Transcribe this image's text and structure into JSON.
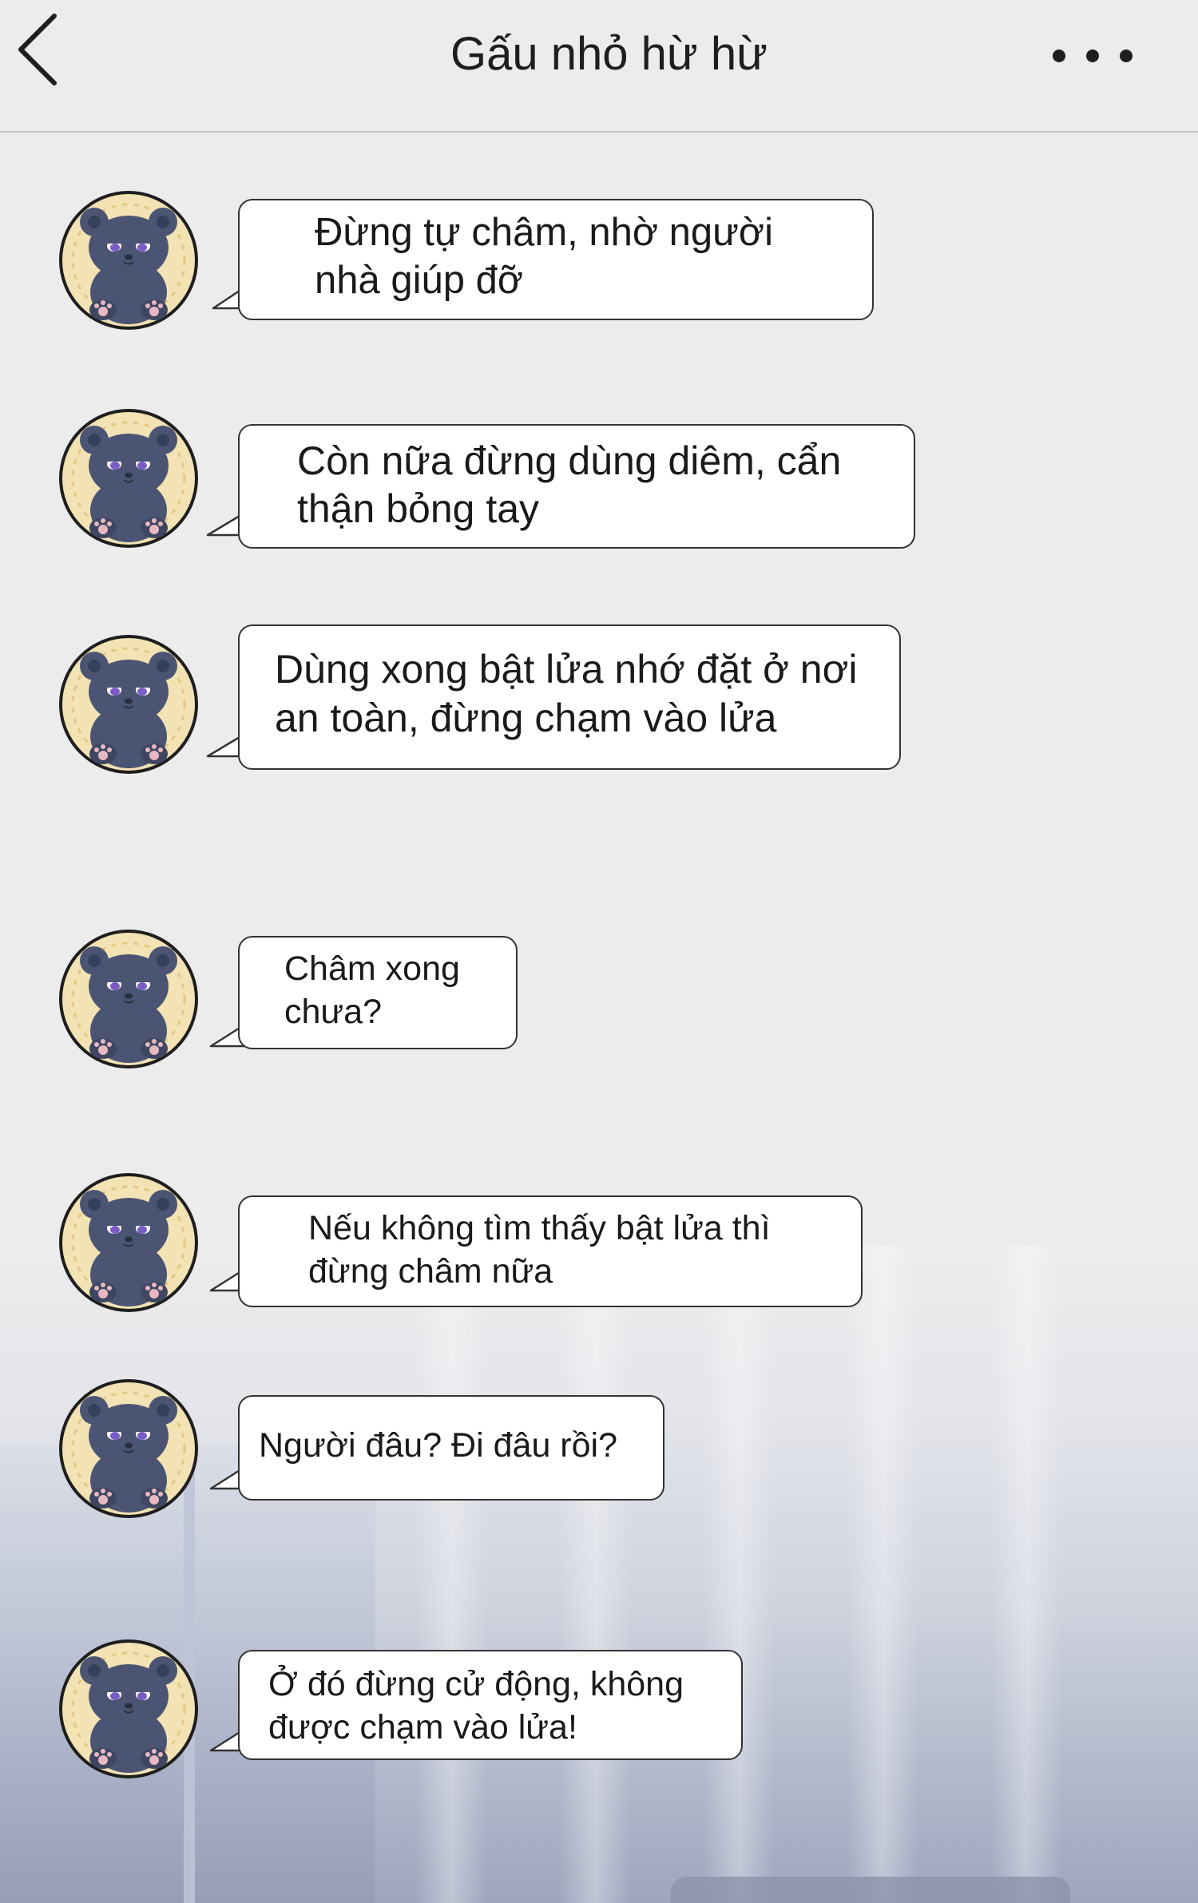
{
  "header": {
    "title": "Gấu nhỏ hừ hừ"
  },
  "contact": {
    "avatar_icon": "teddy-bear-avatar"
  },
  "messages": [
    {
      "text": "Đừng tự châm, nhờ người\nnhà giúp đỡ"
    },
    {
      "text": "Còn nữa đừng dùng diêm, cẩn\nthận bỏng tay"
    },
    {
      "text": "Dùng xong bật lửa nhớ đặt ở nơi\nan toàn, đừng chạm vào lửa"
    },
    {
      "text": "Châm xong\nchưa?"
    },
    {
      "text": "Nếu không tìm thấy bật lửa thì\nđừng châm nữa"
    },
    {
      "text": "Người đâu? Đi đâu rồi?"
    },
    {
      "text": "Ở đó đừng cử động, không\nđược chạm vào lửa!"
    }
  ],
  "colors": {
    "background": "#ececec",
    "bubble": "#ffffff",
    "bubble_border": "#333333",
    "avatar_bg": "#f2e2b4",
    "bear": "#4b5573"
  }
}
